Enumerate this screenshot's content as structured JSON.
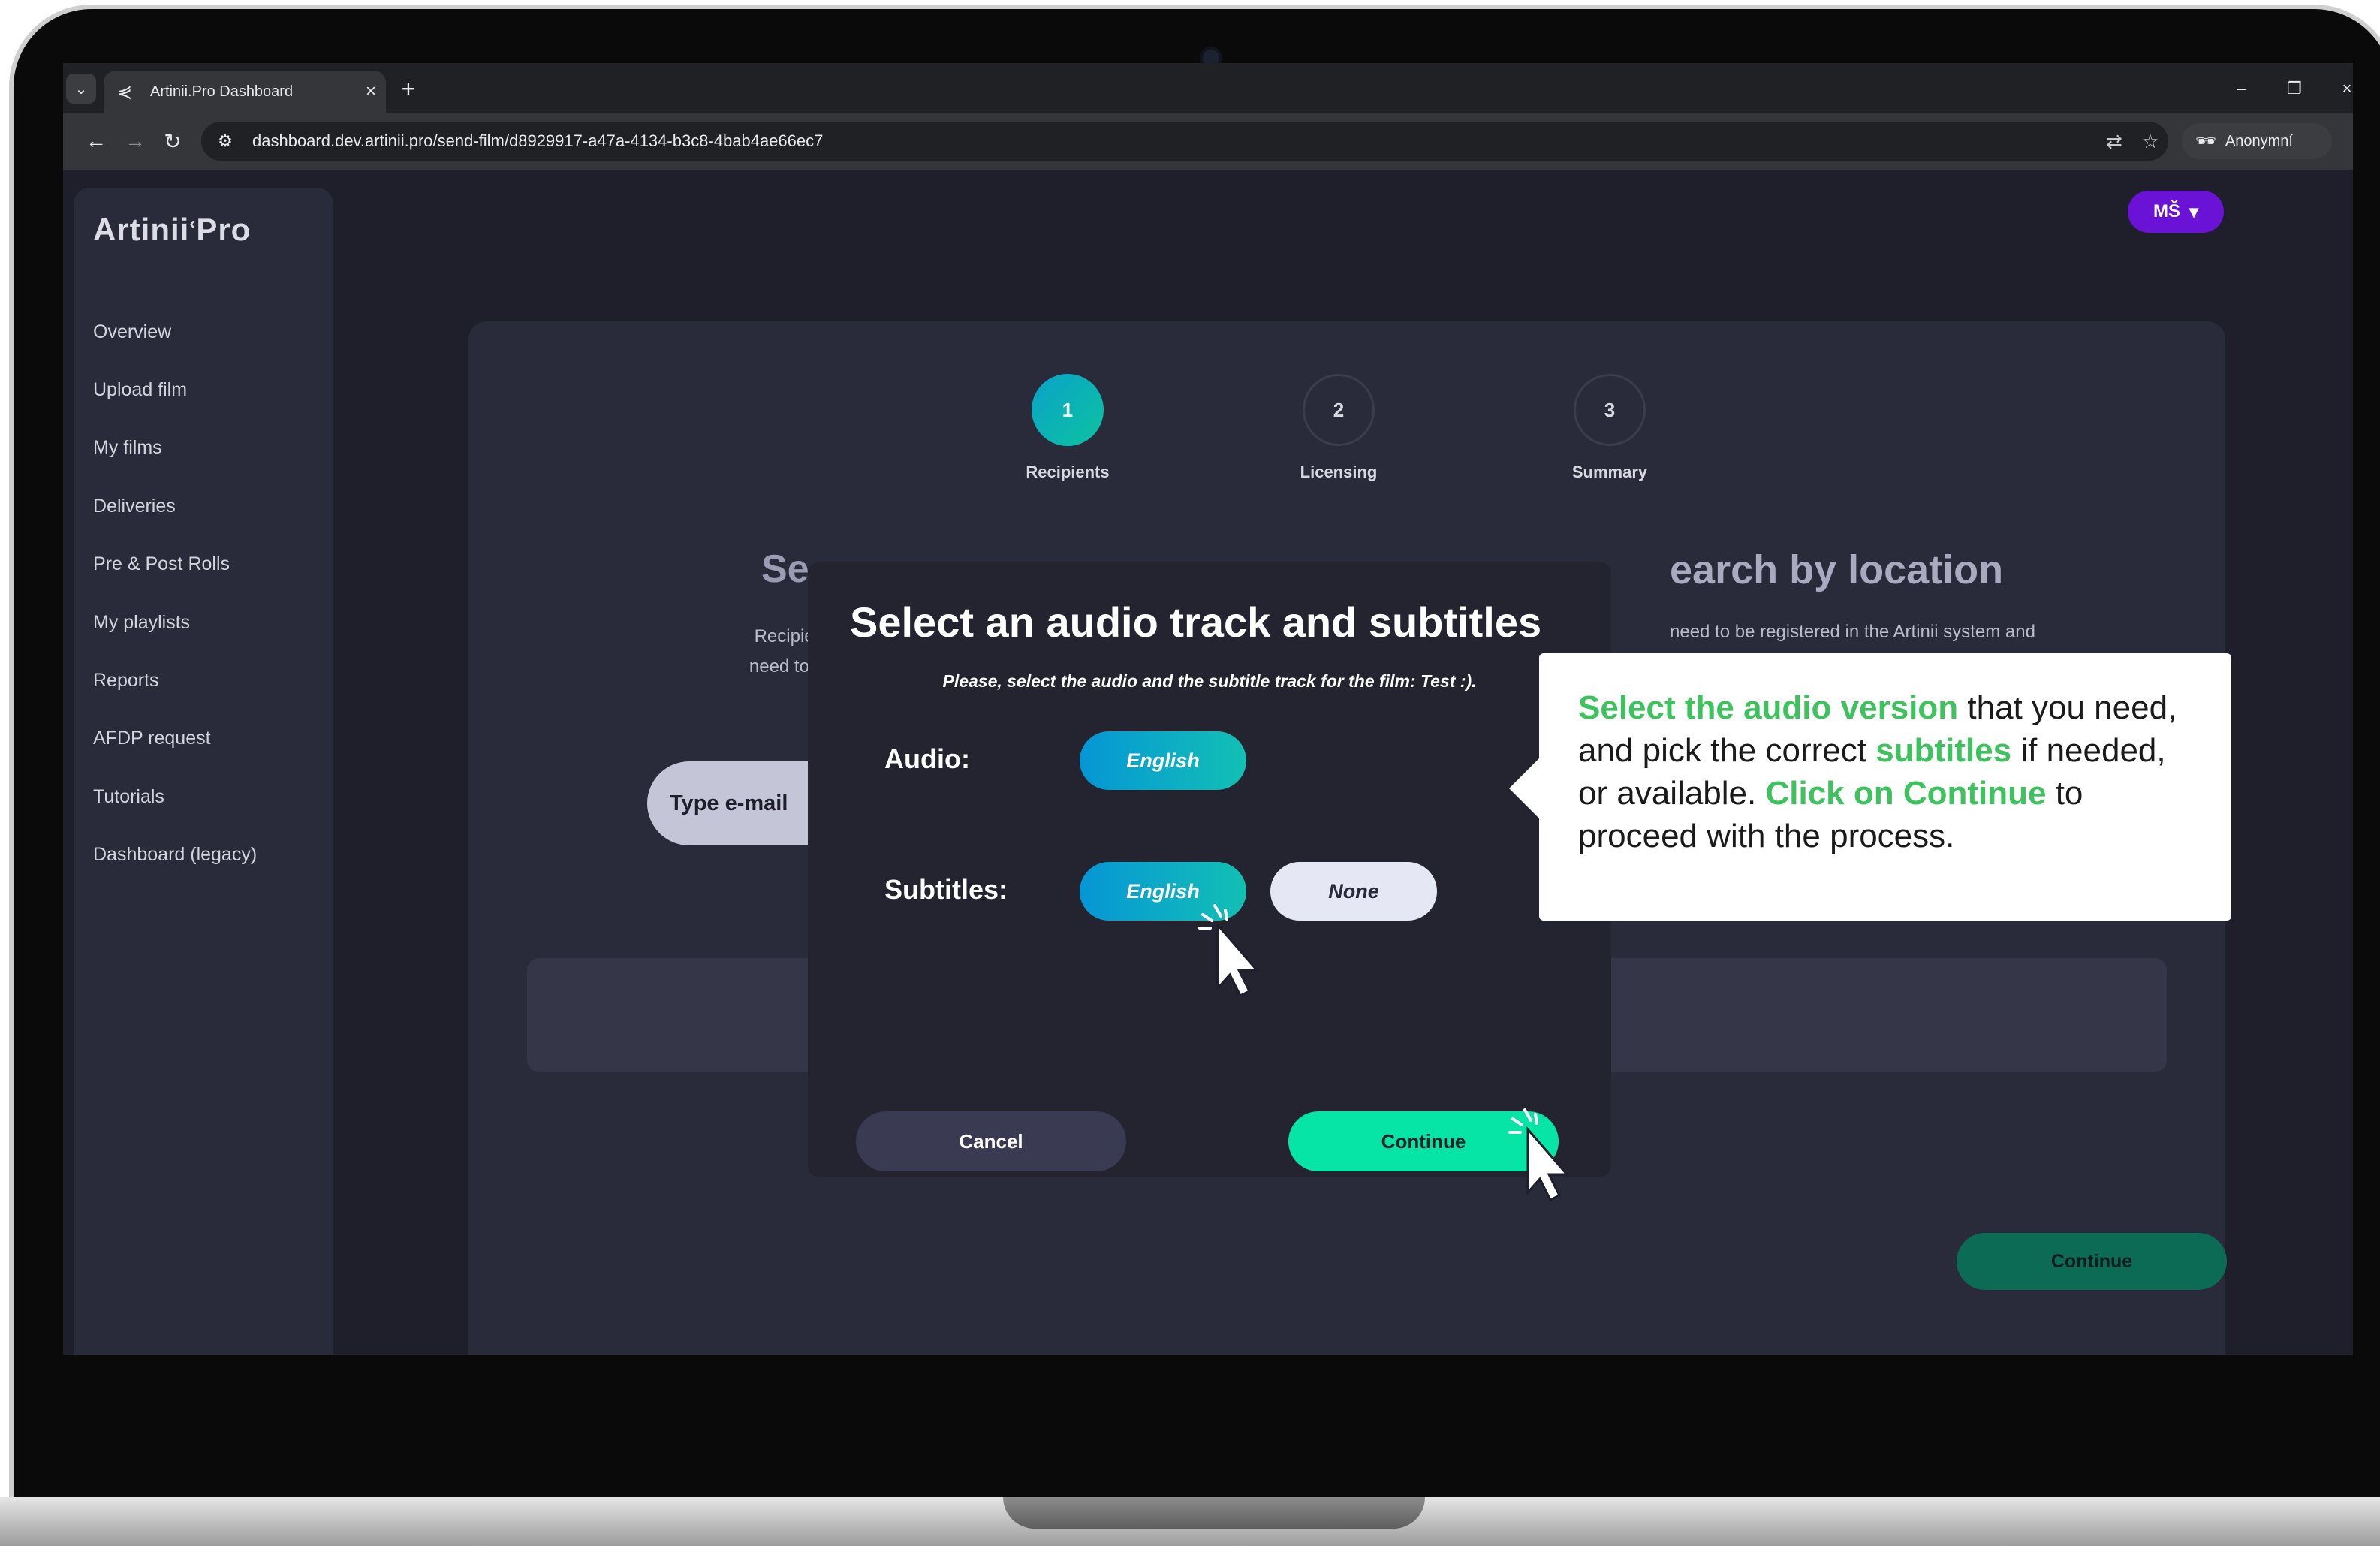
{
  "browser": {
    "tab_title": "Artinii.Pro Dashboard",
    "url": "dashboard.dev.artinii.pro/send-film/d8929917-a47a-4134-b3c8-4bab4ae66ec7",
    "profile_label": "Anonymní"
  },
  "app": {
    "logo": "Artinii",
    "logo_suffix": "Pro",
    "user_initials": "MŠ",
    "sidebar": {
      "items": [
        {
          "label": "Overview"
        },
        {
          "label": "Upload film"
        },
        {
          "label": "My films"
        },
        {
          "label": "Deliveries"
        },
        {
          "label": "Pre & Post Rolls"
        },
        {
          "label": "My playlists"
        },
        {
          "label": "Reports"
        },
        {
          "label": "AFDP request"
        },
        {
          "label": "Tutorials"
        },
        {
          "label": "Dashboard (legacy)"
        }
      ]
    },
    "steps": [
      {
        "number": "1",
        "label": "Recipients",
        "active": true
      },
      {
        "number": "2",
        "label": "Licensing",
        "active": false
      },
      {
        "number": "3",
        "label": "Summary",
        "active": false
      }
    ],
    "background": {
      "heading_left": "Se",
      "heading_right": "earch by location",
      "text_left_1": "Recipients ne",
      "text_left_2": "need to have t",
      "text_right": "need to be registered in the Artinii system and",
      "email_button": "Type e-mail",
      "continue_button": "Continue"
    }
  },
  "modal": {
    "title": "Select an audio track and subtitles",
    "subtitle": "Please, select the audio and the subtitle track for the film: Test :).",
    "audio_label": "Audio:",
    "audio_options": [
      {
        "label": "English",
        "selected": true
      }
    ],
    "subtitles_label": "Subtitles:",
    "subtitle_options": [
      {
        "label": "English",
        "selected": true
      },
      {
        "label": "None",
        "selected": false
      }
    ],
    "cancel": "Cancel",
    "continue": "Continue"
  },
  "callout": {
    "part1": "Select the audio version",
    "part2": " that you need, and pick the correct ",
    "part3": "subtitles",
    "part4": " if needed, or available. ",
    "part5": "Click on Continue",
    "part6": " to proceed with the process."
  },
  "colors": {
    "accent_green": "#07e5a6",
    "callout_highlight": "#3ec25d",
    "user_badge": "#6a12d6",
    "selected_gradient_start": "#0696d6"
  }
}
